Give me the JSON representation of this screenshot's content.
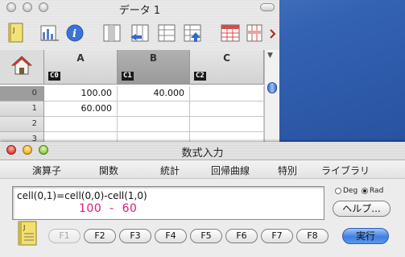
{
  "data_window": {
    "title": "データ 1",
    "columns": [
      {
        "letter": "A",
        "id": "C0"
      },
      {
        "letter": "B",
        "id": "C1"
      },
      {
        "letter": "C",
        "id": "C2"
      }
    ],
    "rows": [
      {
        "index": "0",
        "cells": [
          "100.00",
          "40.000",
          ""
        ]
      },
      {
        "index": "1",
        "cells": [
          "60.000",
          "",
          ""
        ]
      },
      {
        "index": "2",
        "cells": [
          "",
          "",
          ""
        ]
      },
      {
        "index": "3",
        "cells": [
          "",
          "",
          ""
        ]
      }
    ],
    "toolbar_icons": [
      "notebook-icon",
      "column-stats-icon",
      "info-icon",
      "insert-column-icon",
      "delete-column-icon",
      "insert-row-icon",
      "delete-row-icon",
      "sheet-icon"
    ],
    "selected_column": "B",
    "selected_row": "0"
  },
  "formula_window": {
    "title": "数式入力",
    "menu": [
      "演算子",
      "関数",
      "統計",
      "回帰曲線",
      "特別",
      "ライブラリ"
    ],
    "formula": "cell(0,1)=cell(0,0)-cell(1,0)",
    "preview": "100  -  60",
    "angle_options": [
      {
        "label": "Deg",
        "selected": false
      },
      {
        "label": "Rad",
        "selected": true
      }
    ],
    "help_button": "ヘルプ...",
    "function_keys": [
      "F1",
      "F2",
      "F3",
      "F4",
      "F5",
      "F6",
      "F7",
      "F8"
    ],
    "execute_button": "実行"
  },
  "colors": {
    "preview_text": "#e0177a",
    "desktop": "#3462b3",
    "default_button": "#3f7fe0"
  }
}
